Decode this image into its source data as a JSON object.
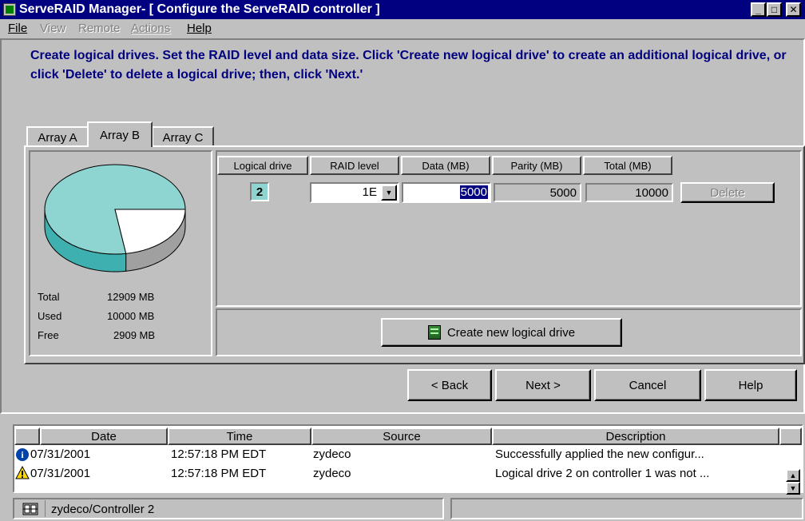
{
  "window": {
    "title": "ServeRAID Manager- [ Configure the ServeRAID controller ]",
    "minimize": "_",
    "maximize": "□",
    "close": "✕"
  },
  "menu": {
    "file": "File",
    "view": "View",
    "remote": "Remote",
    "actions": "Actions",
    "help": "Help"
  },
  "instructions": "Create logical drives. Set the RAID level and data size.  Click 'Create new logical drive' to create an additional logical drive, or click 'Delete' to delete a logical drive; then, click 'Next.'",
  "tabs": [
    "Array A",
    "Array B",
    "Array C"
  ],
  "selected_tab": "Array B",
  "array_stats": {
    "total_label": "Total",
    "total_value": "12909 MB",
    "used_label": "Used",
    "used_value": "10000 MB",
    "free_label": "Free",
    "free_value": "2909 MB",
    "used_fraction": 0.775
  },
  "table": {
    "headers": [
      "Logical drive",
      "RAID level",
      "Data (MB)",
      "Parity (MB)",
      "Total (MB)"
    ],
    "row": {
      "logical_drive": "2",
      "raid_level": "1E",
      "data": "5000",
      "parity": "5000",
      "total": "10000",
      "delete_label": "Delete"
    }
  },
  "create_button": "Create new logical drive",
  "nav_buttons": {
    "back": "< Back",
    "next": "Next >",
    "cancel": "Cancel",
    "help": "Help"
  },
  "log": {
    "headers": [
      "Date",
      "Time",
      "Source",
      "Description"
    ],
    "rows": [
      {
        "icon": "info-icon",
        "date": "07/31/2001",
        "time": "12:57:18 PM EDT",
        "source": "zydeco",
        "description": "Successfully applied the new configur..."
      },
      {
        "icon": "warning-icon",
        "date": "07/31/2001",
        "time": "12:57:18 PM EDT",
        "source": "zydeco",
        "description": "Logical drive 2 on controller 1 was not ..."
      }
    ]
  },
  "status_bar": {
    "path": "zydeco/Controller 2"
  },
  "colors": {
    "title_bg": "#000080",
    "instruction_text": "#000080",
    "pie_used": "#8ed4d0",
    "pie_free": "#ffffff",
    "face": "#c0c0c0"
  }
}
